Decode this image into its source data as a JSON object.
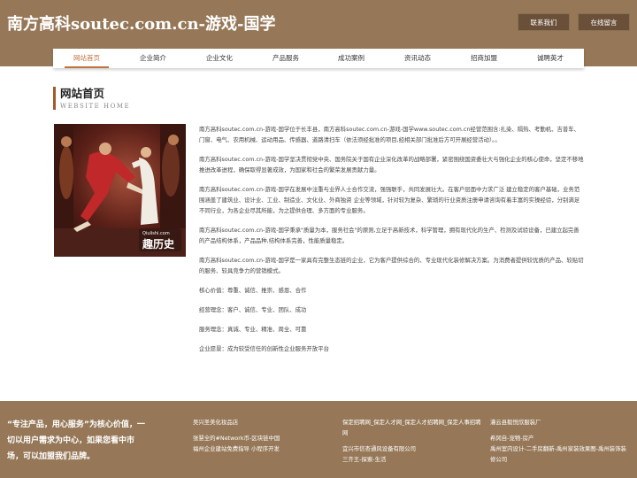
{
  "header": {
    "title": "南方高科soutec.com.cn-游戏-国学",
    "contact_label": "联系我们",
    "message_label": "在线留言"
  },
  "nav": {
    "items": [
      "网站首页",
      "企业简介",
      "企业文化",
      "产品服务",
      "成功案例",
      "资讯动态",
      "招商加盟",
      "诚聘英才"
    ]
  },
  "section": {
    "title": "网站首页",
    "subtitle": "WEBSITE HOME"
  },
  "photo": {
    "watermark_url": "Qiulishi.com",
    "watermark_text": "趣历史"
  },
  "content": {
    "paragraphs": [
      "南方高科soutec.com.cn-游戏-国学位于长丰县，南方高科soutec.com.cn-游戏-国学www.soutec.com.cn经营范围含:扎染、隔热、考勤机、吉普车、门窗、电气、农用机械、运动用品、传感器、道路清扫车（依法须经批准的项目,经相关部门批准后方可开展经营活动）。。",
      "南方高科soutec.com.cn-游戏-国学坚决贯彻党中央、国务院关于国有企业深化改革的战略部署，紧密围绕国资委壮大与强化企业的核心使命，坚定不移地推进改革进程，确保取得显著成效，为国家和社会的繁荣发展贡献力量。",
      "南方高科soutec.com.cn-游戏-国学在发展中注重与业界人士合作交流，强强联手，共同发展壮大。在客户层面中力求广泛 建立稳定的客户基础，业务范围涵盖了建筑业、设计业、工业、制造业、文化业、外商独资 企业等领域，针对较为复杂、繁琐的行业资质注册申请咨询有着丰富的实操经验，分别满足 不同行业，为各企业尽其所能，为之提供合理、多方面的专业服务。",
      "南方高科soutec.com.cn-游戏-国学秉承\"质量为本，服务社会\"的原则,立足于高新技术，科学管理，拥有现代化的生产、检测及试验设备，已建立起完善的产品结构体系，产品品种,结构体系完善，性能质量稳定。",
      "南方高科soutec.com.cn-游戏-国学是一家具有完整生态链的企业，它为客户提供综合的、专业现代化装修解决方案。为消费者提供较优质的产品、较贴切的服务、较具竞争力的营销模式。",
      "核心价值：尊重、诚信、推崇、感恩、合作",
      "经营理念：客户、诚信、专业、团队、成功",
      "服务理念：真诚、专业、精准、周全、可靠",
      "企业愿景：成为较受信任的创新性企业服务开放平台"
    ]
  },
  "footer": {
    "slogan": "“专注产品，用心服务”为核心价值，一切以用户需求为中心，如果您看中市场，可以加盟我们品牌。",
    "col1": [
      "吴兴圣美化妆品店",
      "张慧全的#Network币-区块链中国",
      "福州企业建站免费指导 小程序开发"
    ],
    "col2": [
      "保定招聘网_保定人才网_保定人才招聘网_保定人事招聘网",
      "宜兴市信杏通风设备有限公司",
      "三齐王-探索-生活"
    ],
    "col3": [
      "灌云县毅悦欣服装厂",
      "希冈自-宠物-房产",
      "禹州室内设计-二手房翻新-禹州家装效果图-禹州装饰装修公司"
    ]
  }
}
